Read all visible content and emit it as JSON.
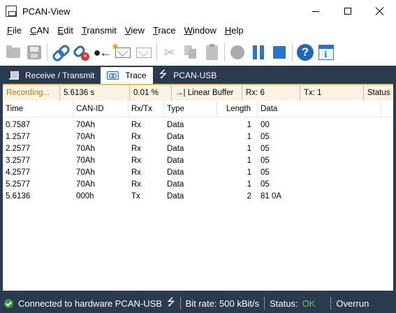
{
  "window": {
    "title": "PCAN-View"
  },
  "menu": [
    {
      "mnemonic": "F",
      "rest": "ile"
    },
    {
      "mnemonic": "C",
      "rest": "AN"
    },
    {
      "mnemonic": "E",
      "rest": "dit"
    },
    {
      "mnemonic": "T",
      "rest": "ransmit"
    },
    {
      "mnemonic": "V",
      "rest": "iew"
    },
    {
      "mnemonic": "T",
      "rest": "race"
    },
    {
      "mnemonic": "W",
      "rest": "indow"
    },
    {
      "mnemonic": "H",
      "rest": "elp"
    }
  ],
  "toolbar": {
    "icons": [
      "open-folder",
      "save",
      "connect",
      "disconnect",
      "plug",
      "new-message",
      "edit-message",
      "cut",
      "copy",
      "paste",
      "record",
      "pause",
      "stop",
      "help",
      "about"
    ]
  },
  "tabs": [
    {
      "label": "Receive / Transmit",
      "active": false
    },
    {
      "label": "Trace",
      "active": true
    },
    {
      "label": "PCAN-USB",
      "active": false
    }
  ],
  "trace_status": {
    "recording": "Recording...",
    "elapsed": "5.6136 s",
    "buffer_fill": "0.01 %",
    "buffer_arrow": "→|",
    "buffer_mode": "Linear Buffer",
    "rx": "Rx: 6",
    "tx": "Tx: 1",
    "status": "Status"
  },
  "columns": {
    "time": "Time",
    "can_id": "CAN-ID",
    "direction": "Rx/Tx",
    "type": "Type",
    "length": "Length",
    "data": "Data"
  },
  "rows": [
    {
      "time": "0.7587",
      "can_id": "70Ah",
      "direction": "Rx",
      "type": "Data",
      "length": "1",
      "data": "00"
    },
    {
      "time": "1.2577",
      "can_id": "70Ah",
      "direction": "Rx",
      "type": "Data",
      "length": "1",
      "data": "05"
    },
    {
      "time": "2.2577",
      "can_id": "70Ah",
      "direction": "Rx",
      "type": "Data",
      "length": "1",
      "data": "05"
    },
    {
      "time": "3.2577",
      "can_id": "70Ah",
      "direction": "Rx",
      "type": "Data",
      "length": "1",
      "data": "05"
    },
    {
      "time": "4.2577",
      "can_id": "70Ah",
      "direction": "Rx",
      "type": "Data",
      "length": "1",
      "data": "05"
    },
    {
      "time": "5.2577",
      "can_id": "70Ah",
      "direction": "Rx",
      "type": "Data",
      "length": "1",
      "data": "05"
    },
    {
      "time": "5.6136",
      "can_id": "000h",
      "direction": "Tx",
      "type": "Data",
      "length": "2",
      "data": "81 0A"
    }
  ],
  "statusbar": {
    "connection": "Connected to hardware PCAN-USB",
    "usb_symbol": "⭍",
    "bitrate": "Bit rate: 500 kBit/s",
    "status_label": "Status:",
    "status_value": "OK",
    "overrun": "Overrun"
  },
  "colors": {
    "panel_dark": "#2b3a4f",
    "recording_bar": "#f9f3e3",
    "recording_border": "#e6c25a",
    "status_ok": "#65c76e",
    "accent_blue": "#2e73c7"
  }
}
